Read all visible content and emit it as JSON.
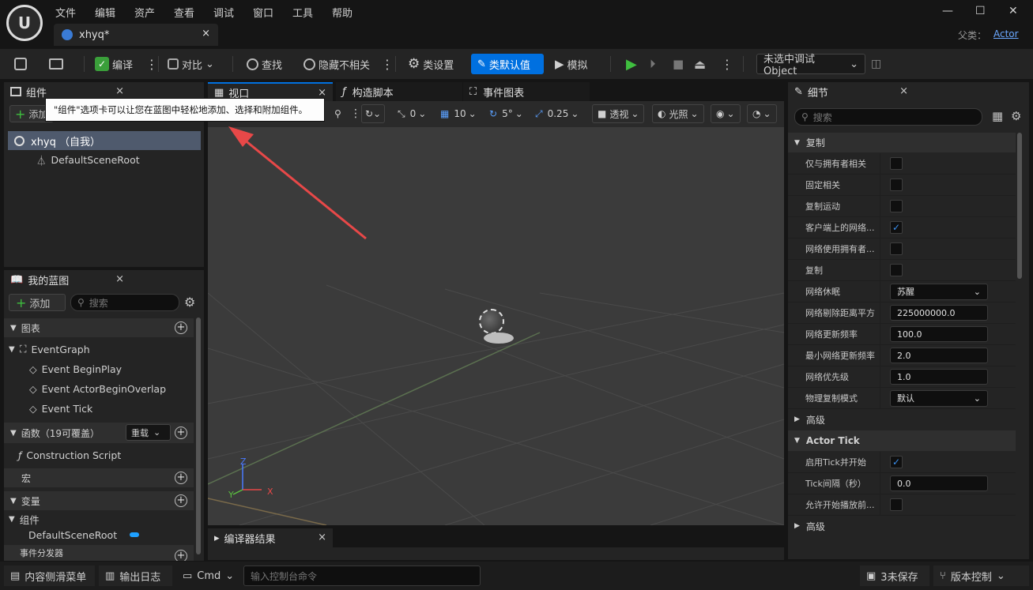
{
  "menu": [
    "文件",
    "编辑",
    "资产",
    "查看",
    "调试",
    "窗口",
    "工具",
    "帮助"
  ],
  "document_tab": {
    "title": "xhyq*",
    "close": "×"
  },
  "parent": {
    "label": "父类：",
    "value": "Actor"
  },
  "window_controls": {
    "minimize": "—",
    "maximize": "☐",
    "close": "✕"
  },
  "toolbar": {
    "compile": "编译",
    "diff": "对比",
    "find": "查找",
    "hide_unrelated": "隐藏不相关",
    "class_settings": "类设置",
    "class_defaults": "类默认值",
    "simulate": "模拟",
    "debug_object": "未选中调试Object"
  },
  "components_panel": {
    "tab": "组件",
    "add": "添加",
    "tooltip": "\"组件\"选项卡可以让您在蓝图中轻松地添加、选择和附加组件。",
    "items": [
      "xhyq （自我）",
      "DefaultSceneRoot"
    ]
  },
  "my_blueprint": {
    "tab": "我的蓝图",
    "add": "添加",
    "search_placeholder": "搜索",
    "graphs_label": "图表",
    "event_graph": "EventGraph",
    "events": [
      "Event BeginPlay",
      "Event ActorBeginOverlap",
      "Event Tick"
    ],
    "functions_label": "函数（19可覆盖）",
    "override": "重载",
    "construction_script": "Construction Script",
    "macros_label": "宏",
    "variables_label": "变量",
    "components_label": "组件",
    "default_scene_root": "DefaultSceneRoot",
    "event_dispatchers": "事件分发器"
  },
  "center_tabs": {
    "viewport": "视口",
    "construction_script": "构造脚本",
    "event_graph": "事件图表"
  },
  "viewport_toolbar": {
    "rotate_snap": "0",
    "grid": "10",
    "angle": "5°",
    "scale": "0.25",
    "perspective": "透视",
    "lighting": "光照"
  },
  "axes": {
    "z": "Z",
    "y": "Y",
    "x": "X"
  },
  "compiler_results": {
    "tab": "编译器结果"
  },
  "details": {
    "tab": "细节",
    "search_placeholder": "搜索",
    "replication_label": "复制",
    "rows": [
      {
        "label": "仅与拥有者相关",
        "type": "check",
        "checked": false
      },
      {
        "label": "固定相关",
        "type": "check",
        "checked": false
      },
      {
        "label": "复制运动",
        "type": "check",
        "checked": false
      },
      {
        "label": "客户端上的网络...",
        "type": "check",
        "checked": true
      },
      {
        "label": "网络使用拥有者...",
        "type": "check",
        "checked": false
      },
      {
        "label": "复制",
        "type": "check",
        "checked": false
      },
      {
        "label": "网络休眠",
        "type": "select",
        "value": "苏醒"
      },
      {
        "label": "网络剔除距离平方",
        "type": "field",
        "value": "225000000.0"
      },
      {
        "label": "网络更新频率",
        "type": "field",
        "value": "100.0"
      },
      {
        "label": "最小网络更新频率",
        "type": "field",
        "value": "2.0"
      },
      {
        "label": "网络优先级",
        "type": "field",
        "value": "1.0"
      },
      {
        "label": "物理复制模式",
        "type": "select",
        "value": "默认"
      }
    ],
    "advanced1": "高级",
    "actor_tick_label": "Actor Tick",
    "tick_rows": [
      {
        "label": "启用Tick并开始",
        "type": "check",
        "checked": true
      },
      {
        "label": "Tick间隔（秒）",
        "type": "field",
        "value": "0.0"
      },
      {
        "label": "允许开始播放前...",
        "type": "check",
        "checked": false
      }
    ],
    "advanced2": "高级"
  },
  "statusbar": {
    "content_drawer": "内容侧滑菜单",
    "output_log": "输出日志",
    "cmd": "Cmd",
    "console_placeholder": "输入控制台命令",
    "unsaved": "3未保存",
    "source_control": "版本控制"
  },
  "colors": {
    "accent_blue": "#0070e0",
    "play_green": "#3fbf3f",
    "arrow_red": "#e84848"
  }
}
